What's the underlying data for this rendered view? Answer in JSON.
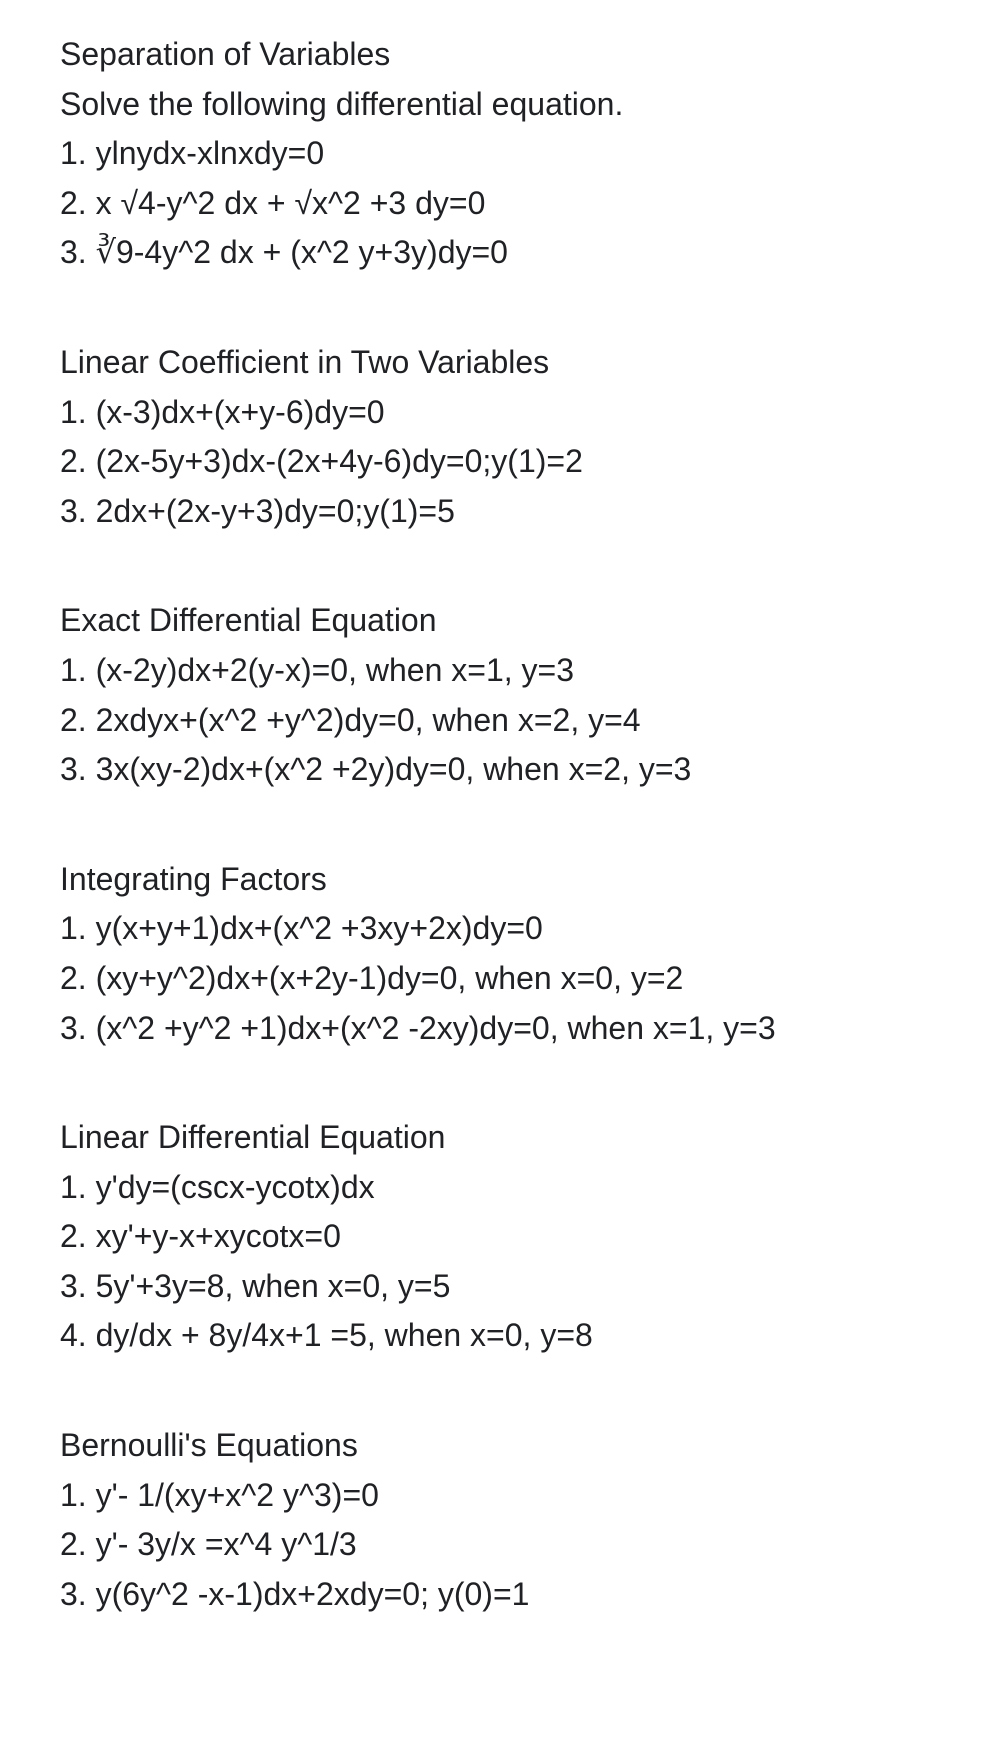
{
  "sections": [
    {
      "heading": "Separation of Variables",
      "subtext": "Solve the following differential equation.",
      "items": [
        "1. ylnydx-xlnxdy=0",
        "2. x √4-y^2 dx + √x^2 +3 dy=0",
        "3. ∛9-4y^2 dx + (x^2 y+3y)dy=0"
      ]
    },
    {
      "heading": "Linear Coefficient in Two Variables",
      "items": [
        "1. (x-3)dx+(x+y-6)dy=0",
        "2. (2x-5y+3)dx-(2x+4y-6)dy=0;y(1)=2",
        "3. 2dx+(2x-y+3)dy=0;y(1)=5"
      ]
    },
    {
      "heading": "Exact Differential Equation",
      "items": [
        "1. (x-2y)dx+2(y-x)=0, when x=1, y=3",
        "2. 2xdyx+(x^2 +y^2)dy=0, when x=2, y=4",
        "3. 3x(xy-2)dx+(x^2 +2y)dy=0, when x=2, y=3"
      ]
    },
    {
      "heading": "Integrating Factors",
      "items": [
        "1. y(x+y+1)dx+(x^2 +3xy+2x)dy=0",
        "2. (xy+y^2)dx+(x+2y-1)dy=0, when x=0, y=2",
        "3. (x^2 +y^2 +1)dx+(x^2 -2xy)dy=0, when x=1, y=3"
      ]
    },
    {
      "heading": "Linear Differential Equation",
      "items": [
        "1. y'dy=(cscx-ycotx)dx",
        "2. xy'+y-x+xycotx=0",
        "3. 5y'+3y=8, when x=0, y=5",
        "4. dy/dx + 8y/4x+1 =5, when x=0, y=8"
      ]
    },
    {
      "heading": "Bernoulli's Equations",
      "items": [
        "1. y'- 1/(xy+x^2 y^3)=0",
        "2. y'- 3y/x =x^4 y^1/3",
        "3. y(6y^2 -x-1)dx+2xdy=0; y(0)=1"
      ]
    }
  ]
}
